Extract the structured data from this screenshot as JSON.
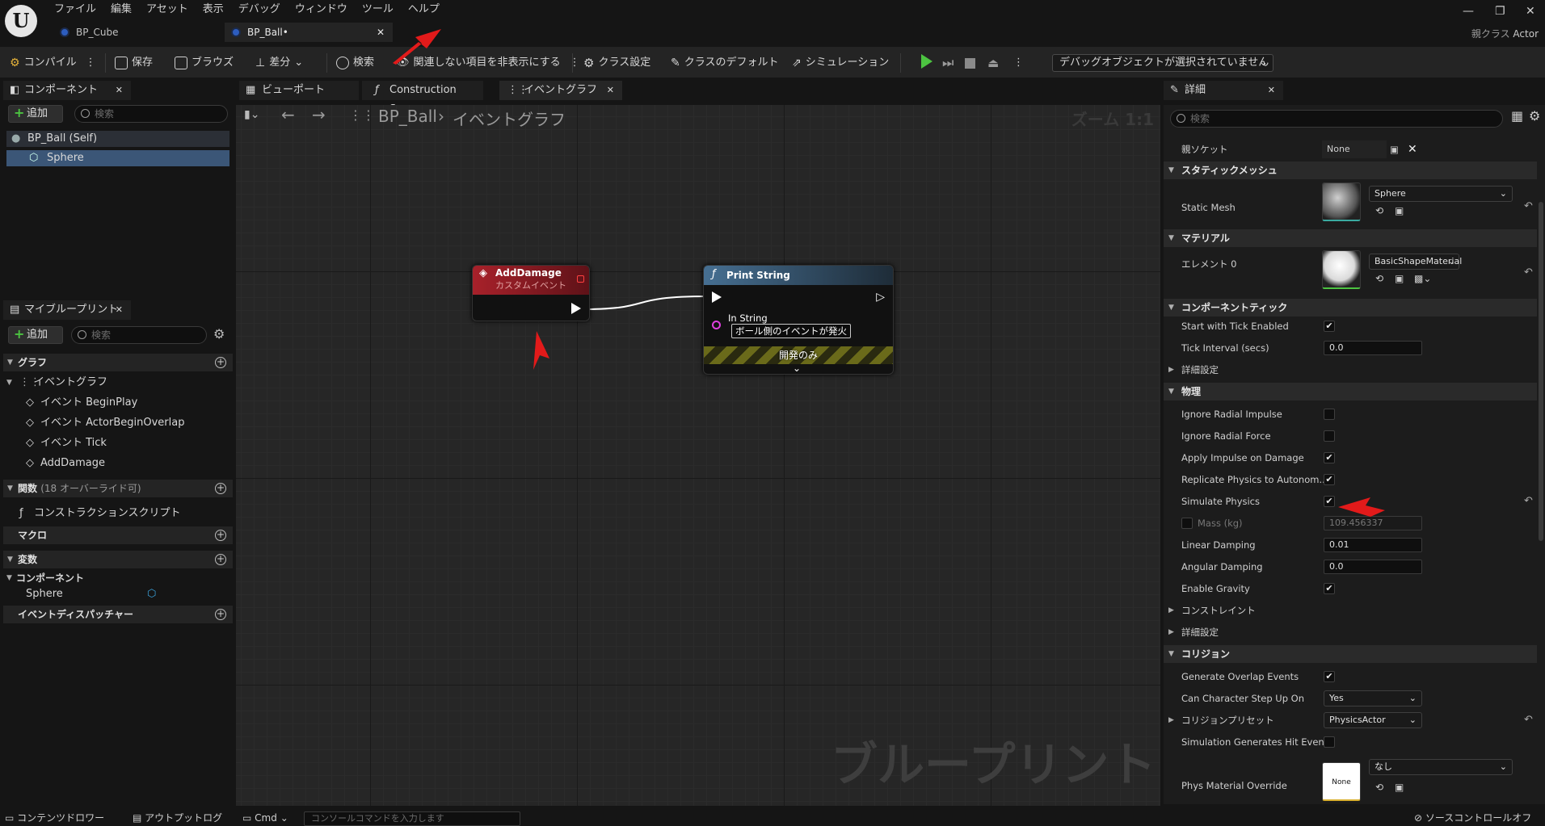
{
  "menu": [
    "ファイル",
    "編集",
    "アセット",
    "表示",
    "デバッグ",
    "ウィンドウ",
    "ツール",
    "ヘルプ"
  ],
  "doc_tabs": [
    {
      "label": "BP_Cube"
    },
    {
      "label": "BP_Ball•"
    }
  ],
  "parent_class": {
    "prefix": "親クラス",
    "value": "Actor"
  },
  "toolbar": {
    "compile": "コンパイル",
    "save": "保存",
    "browse": "ブラウズ",
    "diff": "差分",
    "search": "検索",
    "hide_unrelated": "関連しない項目を非表示にする",
    "class_settings": "クラス設定",
    "class_defaults": "クラスのデフォルト",
    "simulation": "シミュレーション",
    "debug_object": "デバッグオブジェクトが選択されていません"
  },
  "components_panel": {
    "title": "コンポーネント",
    "add": "追加",
    "search_placeholder": "検索",
    "items": [
      "BP_Ball (Self)",
      "Sphere"
    ]
  },
  "blueprint_panel": {
    "title": "マイブループリント",
    "add": "追加",
    "search_placeholder": "検索",
    "graph_section": "グラフ",
    "event_graph": "イベントグラフ",
    "events": [
      "イベント BeginPlay",
      "イベント ActorBeginOverlap",
      "イベント Tick",
      "AddDamage"
    ],
    "functions_section": "関数",
    "functions_note": "(18 オーバーライド可)",
    "construction_script": "コンストラクションスクリプト",
    "macros_section": "マクロ",
    "variables_section": "変数",
    "components_group": "コンポーネント",
    "component_var": "Sphere",
    "dispatchers_section": "イベントディスパッチャー"
  },
  "editor_tabs": [
    "ビューポート",
    "Construction Scr...",
    "イベントグラフ"
  ],
  "graph": {
    "breadcrumb_root": "BP_Ball",
    "breadcrumb_current": "イベントグラフ",
    "zoom": "ズーム 1:1",
    "watermark": "ブループリント",
    "custom_event": {
      "title": "AddDamage",
      "subtitle": "カスタムイベント"
    },
    "print_node": {
      "title": "Print String",
      "pin_label": "In String",
      "pin_value": "ボール側のイベントが発火",
      "dev_only": "開発のみ"
    }
  },
  "details": {
    "title": "詳細",
    "search_placeholder": "検索",
    "parent_socket_label": "親ソケット",
    "parent_socket_value": "None",
    "sec_static_mesh": "スタティックメッシュ",
    "static_mesh_label": "Static Mesh",
    "static_mesh_value": "Sphere",
    "sec_material": "マテリアル",
    "element0_label": "エレメント 0",
    "element0_value": "BasicShapeMaterial",
    "sec_tick": "コンポーネントティック",
    "tick_enabled_label": "Start with Tick Enabled",
    "tick_interval_label": "Tick Interval (secs)",
    "tick_interval_value": "0.0",
    "advanced": "詳細設定",
    "sec_physics": "物理",
    "ignore_radial_impulse": "Ignore Radial Impulse",
    "ignore_radial_force": "Ignore Radial Force",
    "apply_impulse_on_damage": "Apply Impulse on Damage",
    "replicate_physics": "Replicate Physics to Autonom...",
    "simulate_physics": "Simulate Physics",
    "mass_label": "Mass (kg)",
    "mass_value": "109.456337",
    "linear_damping_label": "Linear Damping",
    "linear_damping_value": "0.01",
    "angular_damping_label": "Angular Damping",
    "angular_damping_value": "0.0",
    "enable_gravity": "Enable Gravity",
    "constraints": "コンストレイント",
    "sec_collision": "コリジョン",
    "gen_overlap": "Generate Overlap Events",
    "step_up_label": "Can Character Step Up On",
    "step_up_value": "Yes",
    "collision_preset_label": "コリジョンプリセット",
    "collision_preset_value": "PhysicsActor",
    "sim_hit_events": "Simulation Generates Hit Even...",
    "phys_mat_label": "Phys Material Override",
    "phys_mat_value": "なし",
    "phys_mat_thumb": "None"
  },
  "bottom_bar": {
    "content_drawer": "コンテンツドロワー",
    "output_log": "アウトプットログ",
    "cmd": "Cmd",
    "console_placeholder": "コンソールコマンドを入力します",
    "source_control": "ソースコントロールオフ"
  }
}
